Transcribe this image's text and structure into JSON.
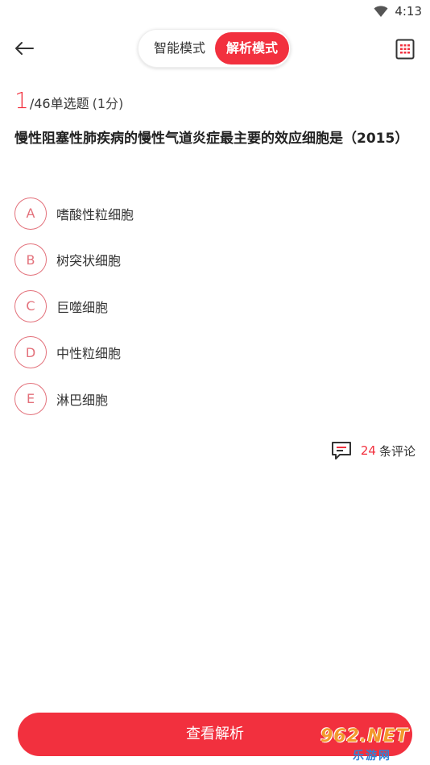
{
  "status_bar": {
    "time": "4:13",
    "wifi_icon": "wifi-icon"
  },
  "top_bar": {
    "back_icon": "arrow-left-icon",
    "modes": {
      "smart": "智能模式",
      "analysis": "解析模式"
    },
    "active_mode": "analysis",
    "card_icon": "answer-sheet-icon"
  },
  "question": {
    "index": "1",
    "total": "/46",
    "type": "单选题",
    "score": "(1分)",
    "text": "慢性阻塞性肺疾病的慢性气道炎症最主要的效应细胞是（2015）",
    "options": [
      {
        "letter": "A",
        "text": "嗜酸性粒细胞"
      },
      {
        "letter": "B",
        "text": "树突状细胞"
      },
      {
        "letter": "C",
        "text": "巨噬细胞"
      },
      {
        "letter": "D",
        "text": "中性粒细胞"
      },
      {
        "letter": "E",
        "text": "淋巴细胞"
      }
    ]
  },
  "comments": {
    "count": "24",
    "label": "条评论",
    "icon": "comment-icon"
  },
  "footer": {
    "view_analysis": "查看解析"
  },
  "watermark": {
    "top": "962.NET",
    "bottom": "乐游网"
  },
  "colors": {
    "accent": "#f2303e",
    "option_border": "#e3717b"
  }
}
